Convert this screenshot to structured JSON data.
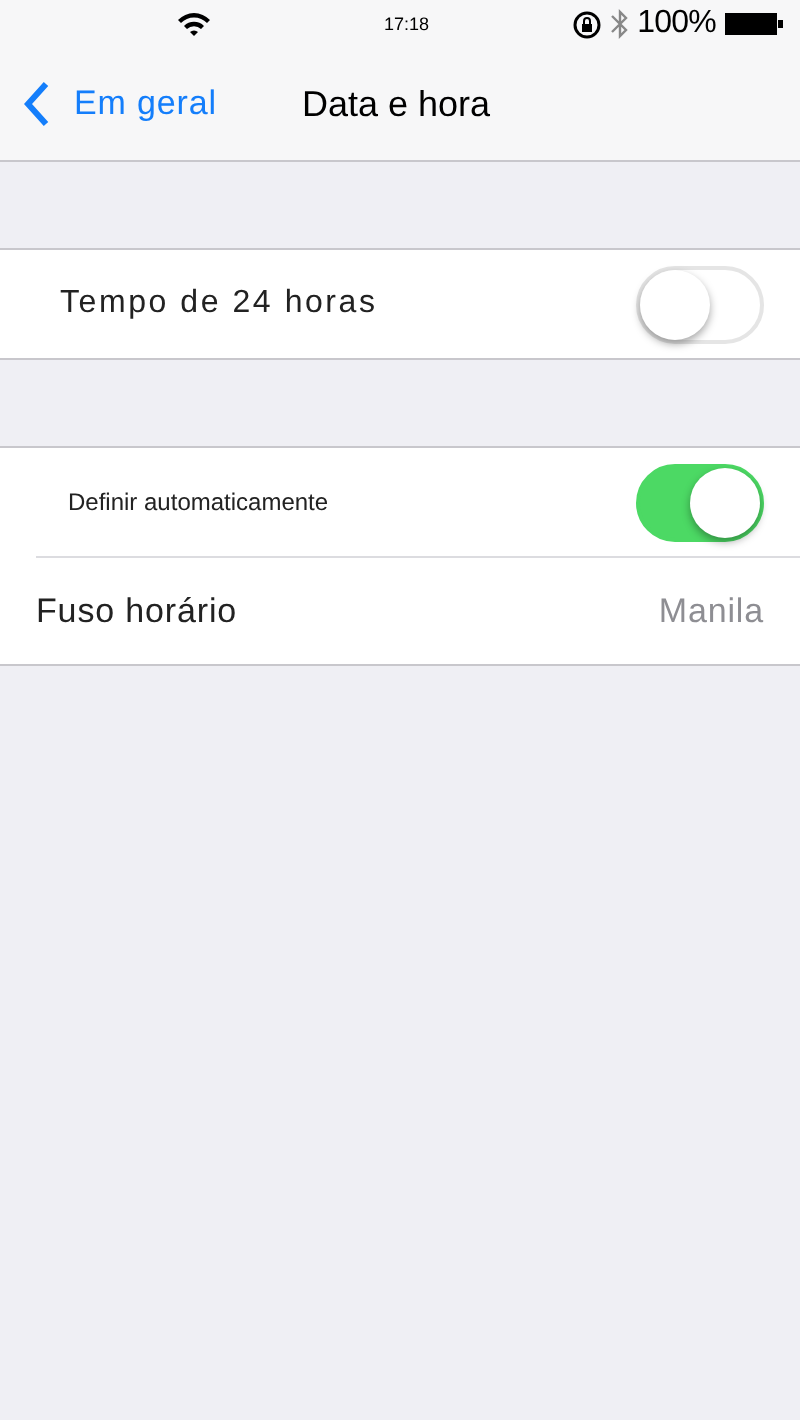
{
  "status_bar": {
    "time": "17:18",
    "battery": "100%"
  },
  "nav": {
    "back": "Em geral",
    "title": "Data e hora"
  },
  "groups": [
    {
      "rows": [
        {
          "kind": "toggle",
          "label": "Tempo de 24 horas",
          "on": false
        }
      ]
    },
    {
      "rows": [
        {
          "kind": "toggle",
          "label": "Definir automaticamente",
          "on": true
        },
        {
          "kind": "value",
          "label": "Fuso horário",
          "value": "Manila"
        }
      ]
    }
  ]
}
